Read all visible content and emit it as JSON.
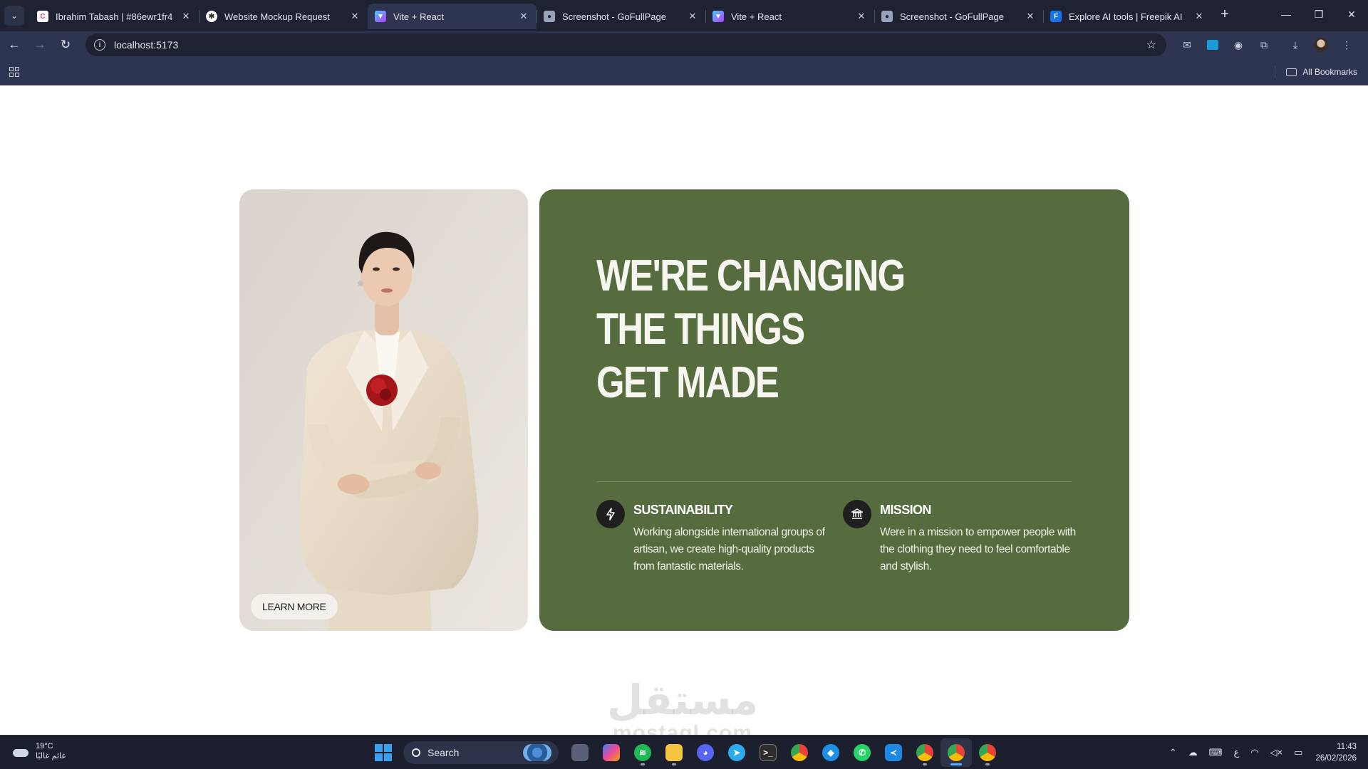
{
  "browser": {
    "tabs": [
      {
        "title": "Ibrahim Tabash | #86ewr1fr4",
        "icon": "clickup-icon",
        "active": false,
        "color": "#ffffff"
      },
      {
        "title": "Website Mockup Request",
        "icon": "chatgpt-icon",
        "active": false,
        "color": "#ffffff"
      },
      {
        "title": "Vite + React",
        "icon": "vite-icon",
        "active": true,
        "color": "#a66cff"
      },
      {
        "title": "Screenshot - GoFullPage",
        "icon": "camera-icon",
        "active": false,
        "color": "#9aa2b8"
      },
      {
        "title": "Vite + React",
        "icon": "vite-icon",
        "active": false,
        "color": "#a66cff"
      },
      {
        "title": "Screenshot - GoFullPage",
        "icon": "camera-icon",
        "active": false,
        "color": "#9aa2b8"
      },
      {
        "title": "Explore AI tools | Freepik AI",
        "icon": "freepik-icon",
        "active": false,
        "color": "#1273eb"
      }
    ],
    "url": "localhost:5173",
    "bookmarks_label": "All Bookmarks"
  },
  "page": {
    "learn_more": "LEARN MORE",
    "headline": [
      "WE'RE CHANGING",
      "THE THINGS",
      "GET MADE"
    ],
    "features": [
      {
        "title": "SUSTAINABILITY",
        "icon": "lightning-icon",
        "description": "Working alongside international groups of artisan, we create high-quality products from fantastic materials."
      },
      {
        "title": "MISSION",
        "icon": "bank-icon",
        "description": "Were in a mission to empower people with the clothing they need to feel comfortable and stylish."
      }
    ],
    "colors": {
      "card_green": "#566b3e",
      "headline": "#f7f5ef",
      "icon_circle": "#1f1f1f"
    }
  },
  "watermark": {
    "arabic": "مستقل",
    "latin": "mostaql.com"
  },
  "taskbar": {
    "temperature": "19°C",
    "weather_condition": "غائم غالبًا",
    "search_placeholder": "Search",
    "time": "11:43",
    "date": "26/02/2026",
    "lang": "ع"
  }
}
